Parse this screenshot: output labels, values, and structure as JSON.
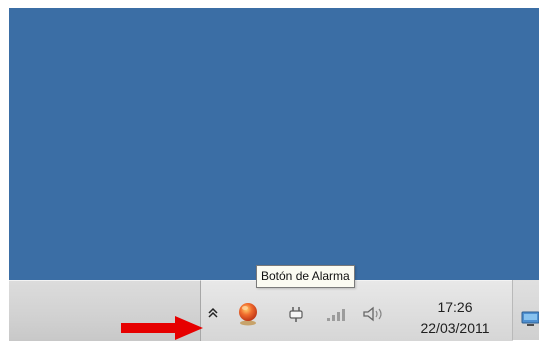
{
  "tooltip": {
    "text": "Botón de Alarma"
  },
  "clock": {
    "time": "17:26",
    "date": "22/03/2011"
  },
  "tray": {
    "icons": [
      "double-chevron-up-icon",
      "alarm-icon",
      "power-icon",
      "signal-icon",
      "volume-icon",
      "monitor-icon"
    ]
  },
  "colors": {
    "desktop": "#3b6ea5",
    "taskbar": "#dcdcdc",
    "annotation_arrow": "#e60000",
    "alarm": "#e04b1f"
  }
}
